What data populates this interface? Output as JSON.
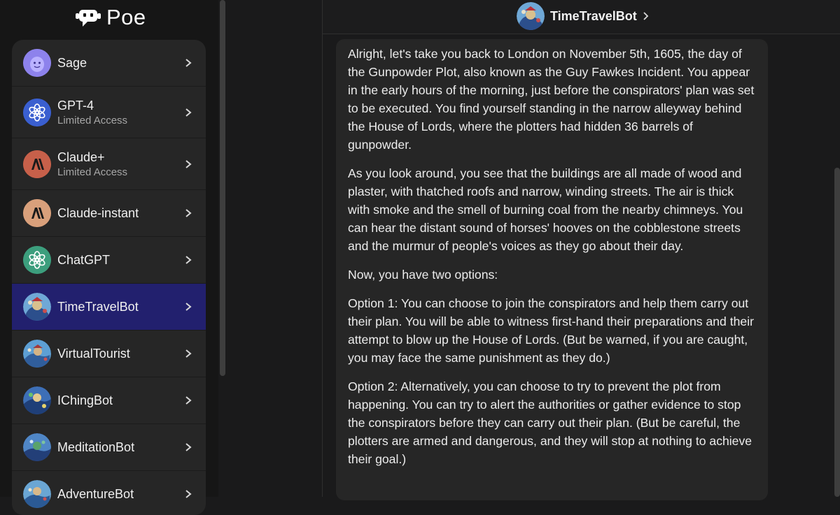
{
  "app": {
    "logo_text": "Poe"
  },
  "sidebar": {
    "bots": [
      {
        "name": "Sage",
        "subtitle": "",
        "avatar": "sage-avatar",
        "active": false
      },
      {
        "name": "GPT-4",
        "subtitle": "Limited Access",
        "avatar": "openai-avatar",
        "active": false
      },
      {
        "name": "Claude+",
        "subtitle": "Limited Access",
        "avatar": "anthropic-avatar",
        "active": false
      },
      {
        "name": "Claude-instant",
        "subtitle": "",
        "avatar": "anthropic-light-avatar",
        "active": false
      },
      {
        "name": "ChatGPT",
        "subtitle": "",
        "avatar": "openai-green-avatar",
        "active": false
      },
      {
        "name": "TimeTravelBot",
        "subtitle": "",
        "avatar": "timetravel-avatar",
        "active": true
      },
      {
        "name": "VirtualTourist",
        "subtitle": "",
        "avatar": "virtualtourist-avatar",
        "active": false
      },
      {
        "name": "IChingBot",
        "subtitle": "",
        "avatar": "iching-avatar",
        "active": false
      },
      {
        "name": "MeditationBot",
        "subtitle": "",
        "avatar": "meditation-avatar",
        "active": false
      },
      {
        "name": "AdventureBot",
        "subtitle": "",
        "avatar": "adventure-avatar",
        "active": false
      }
    ]
  },
  "header": {
    "title": "TimeTravelBot"
  },
  "message": {
    "paragraphs": [
      "Alright, let's take you back to London on November 5th, 1605, the day of the Gunpowder Plot, also known as the Guy Fawkes Incident. You appear in the early hours of the morning, just before the conspirators' plan was set to be executed. You find yourself standing in the narrow alleyway behind the House of Lords, where the plotters had hidden 36 barrels of gunpowder.",
      "As you look around, you see that the buildings are all made of wood and plaster, with thatched roofs and narrow, winding streets. The air is thick with smoke and the smell of burning coal from the nearby chimneys. You can hear the distant sound of horses' hooves on the cobblestone streets and the murmur of people's voices as they go about their day.",
      "Now, you have two options:",
      "Option 1: You can choose to join the conspirators and help them carry out their plan. You will be able to witness first-hand their preparations and their attempt to blow up the House of Lords. (But be warned, if you are caught, you may face the same punishment as they do.)",
      "Option 2: Alternatively, you can choose to try to prevent the plot from happening. You can try to alert the authorities or gather evidence to stop the conspirators before they can carry out their plan. (But be careful, the plotters are armed and dangerous, and they will stop at nothing to achieve their goal.)"
    ]
  },
  "colors": {
    "active_item": "#22206e",
    "panel": "#262626",
    "background": "#1a1a1b"
  }
}
